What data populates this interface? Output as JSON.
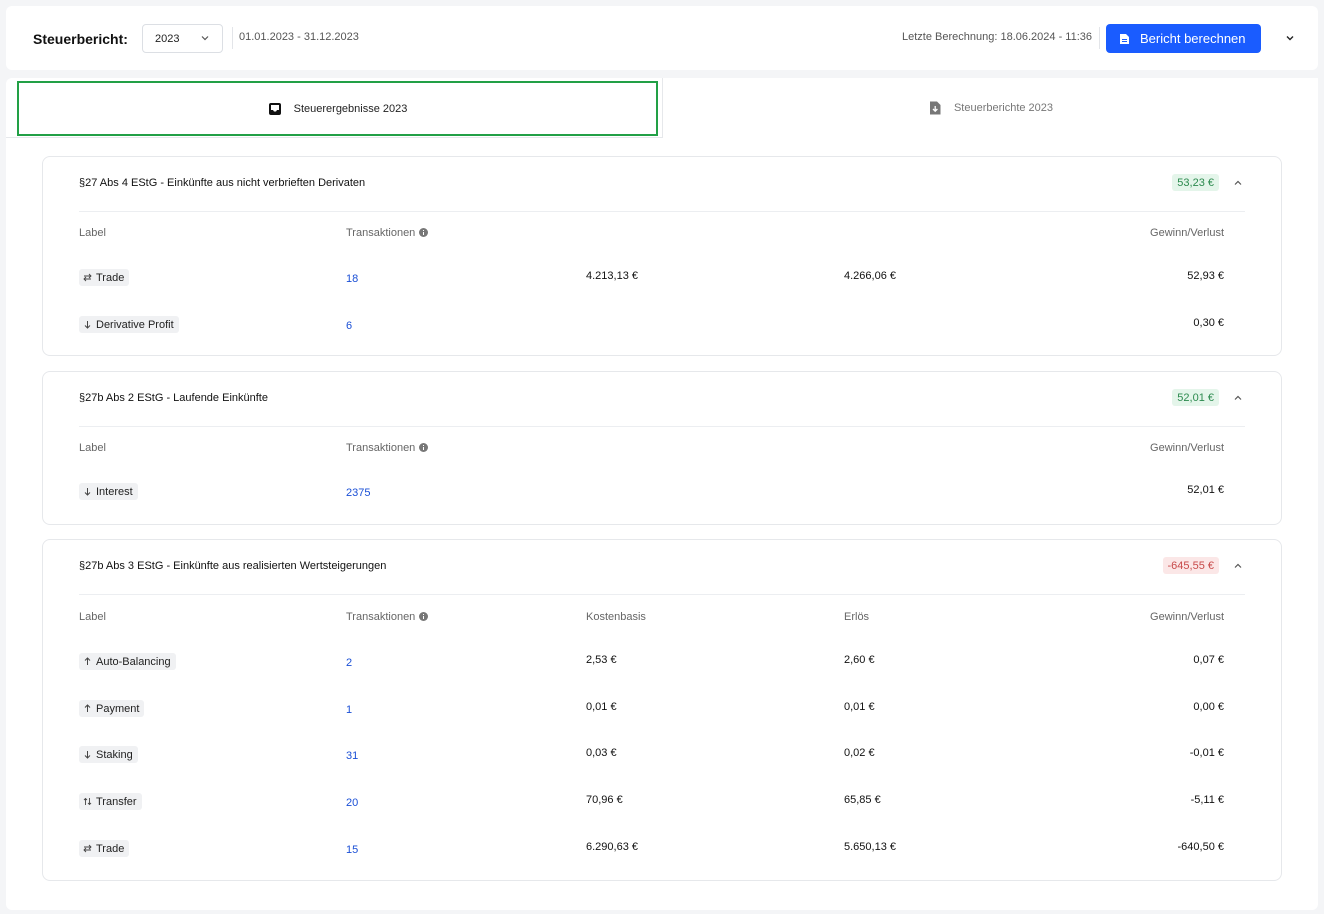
{
  "header": {
    "title": "Steuerbericht:",
    "year": "2023",
    "date_range": "01.01.2023 - 31.12.2023",
    "last_calc": "Letzte Berechnung: 18.06.2024 - 11:36",
    "calc_button": "Bericht berechnen"
  },
  "tabs": [
    {
      "label": "Steuerergebnisse 2023",
      "icon": "inbox-icon"
    },
    {
      "label": "Steuerberichte 2023",
      "icon": "file-download-icon"
    }
  ],
  "columns": {
    "label": "Label",
    "transactions": "Transaktionen",
    "cost_basis": "Kostenbasis",
    "proceeds": "Erlös",
    "gain_loss": "Gewinn/Verlust"
  },
  "sections": [
    {
      "title": "§27 Abs 4 EStG - Einkünfte aus nicht verbrieften Derivaten",
      "total": "53,23 €",
      "rows": [
        {
          "label": "Trade",
          "icon": "swap-icon",
          "txn": "18",
          "cost": "4.213,13 €",
          "proceeds": "4.266,06 €",
          "gain": "52,93 €"
        },
        {
          "label": "Derivative Profit",
          "icon": "arrow-down-icon",
          "txn": "6",
          "cost": "",
          "proceeds": "",
          "gain": "0,30 €"
        }
      ]
    },
    {
      "title": "§27b Abs 2 EStG - Laufende Einkünfte",
      "total": "52,01 €",
      "rows": [
        {
          "label": "Interest",
          "icon": "arrow-down-icon",
          "txn": "2375",
          "cost": "",
          "proceeds": "",
          "gain": "52,01 €"
        }
      ]
    },
    {
      "title": "§27b Abs 3 EStG - Einkünfte aus realisierten Wertsteigerungen",
      "total": "-645,55 €",
      "rows": [
        {
          "label": "Auto-Balancing",
          "icon": "arrow-up-icon",
          "txn": "2",
          "cost": "2,53 €",
          "proceeds": "2,60 €",
          "gain": "0,07 €"
        },
        {
          "label": "Payment",
          "icon": "arrow-up-icon",
          "txn": "1",
          "cost": "0,01 €",
          "proceeds": "0,01 €",
          "gain": "0,00 €"
        },
        {
          "label": "Staking",
          "icon": "arrow-down-icon",
          "txn": "31",
          "cost": "0,03 €",
          "proceeds": "0,02 €",
          "gain": "-0,01 €"
        },
        {
          "label": "Transfer",
          "icon": "transfer-icon",
          "txn": "20",
          "cost": "70,96 €",
          "proceeds": "65,85 €",
          "gain": "-5,11 €"
        },
        {
          "label": "Trade",
          "icon": "swap-icon",
          "txn": "15",
          "cost": "6.290,63 €",
          "proceeds": "5.650,13 €",
          "gain": "-640,50 €"
        }
      ]
    }
  ],
  "colors": {
    "primary": "#1a5cff",
    "active_tab_border": "#22a046",
    "positive": "#2c8a4e",
    "negative": "#c84a4a",
    "link": "#1a4fd6"
  }
}
